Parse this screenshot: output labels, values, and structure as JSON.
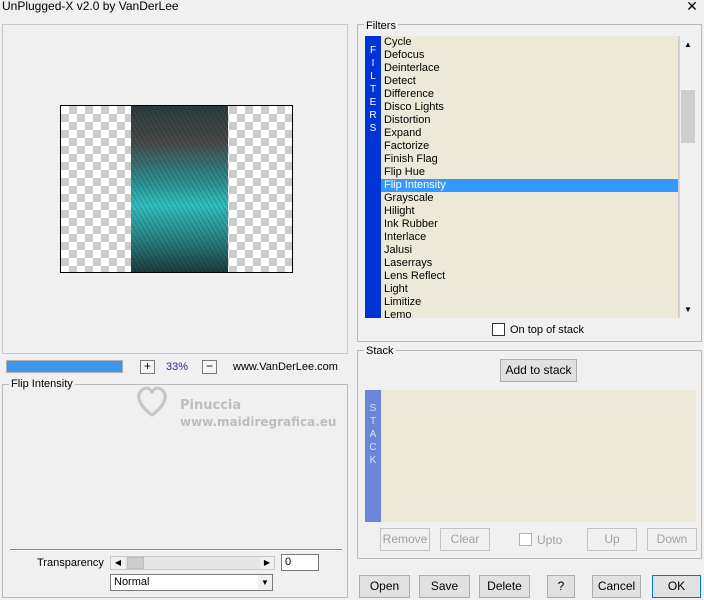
{
  "window": {
    "title": "UnPlugged-X v2.0 by VanDerLee",
    "close_glyph": "✕"
  },
  "preview": {
    "progress_percent": 100
  },
  "zoom": {
    "plus_label": "+",
    "minus_label": "−",
    "value": "33%"
  },
  "website": "www.VanDerLee.com",
  "filter_settings": {
    "group_label": "Flip Intensity",
    "transparency_label": "Transparency",
    "transparency_value": "0",
    "blend_mode": "Normal"
  },
  "filters": {
    "group_label": "Filters",
    "strip_letters": [
      "F",
      "I",
      "L",
      "T",
      "E",
      "R",
      "S"
    ],
    "items": [
      "Cycle",
      "Defocus",
      "Deinterlace",
      "Detect",
      "Difference",
      "Disco Lights",
      "Distortion",
      "Expand",
      "Factorize",
      "Finish Flag",
      "Flip Hue",
      "Flip Intensity",
      "Grayscale",
      "Hilight",
      "Ink Rubber",
      "Interlace",
      "Jalusi",
      "Laserrays",
      "Lens Reflect",
      "Light",
      "Limitize",
      "Lemo"
    ],
    "selected_index": 11,
    "on_top_label": "On top of stack"
  },
  "stack": {
    "group_label": "Stack",
    "add_button": "Add to stack",
    "strip_letters": [
      "S",
      "T",
      "A",
      "C",
      "K"
    ],
    "remove": "Remove",
    "clear": "Clear",
    "upto": "Upto",
    "up": "Up",
    "down": "Down"
  },
  "footer": {
    "open": "Open",
    "save": "Save",
    "delete": "Delete",
    "help": "?",
    "cancel": "Cancel",
    "ok": "OK"
  },
  "watermark": {
    "line1": "Pinuccia",
    "line2": "www.maidiregrafica.eu"
  },
  "colors": {
    "filters_strip": "#0033d6",
    "stack_strip": "#6b85d9",
    "selection": "#3399ff",
    "list_bg": "#ece9d8"
  }
}
